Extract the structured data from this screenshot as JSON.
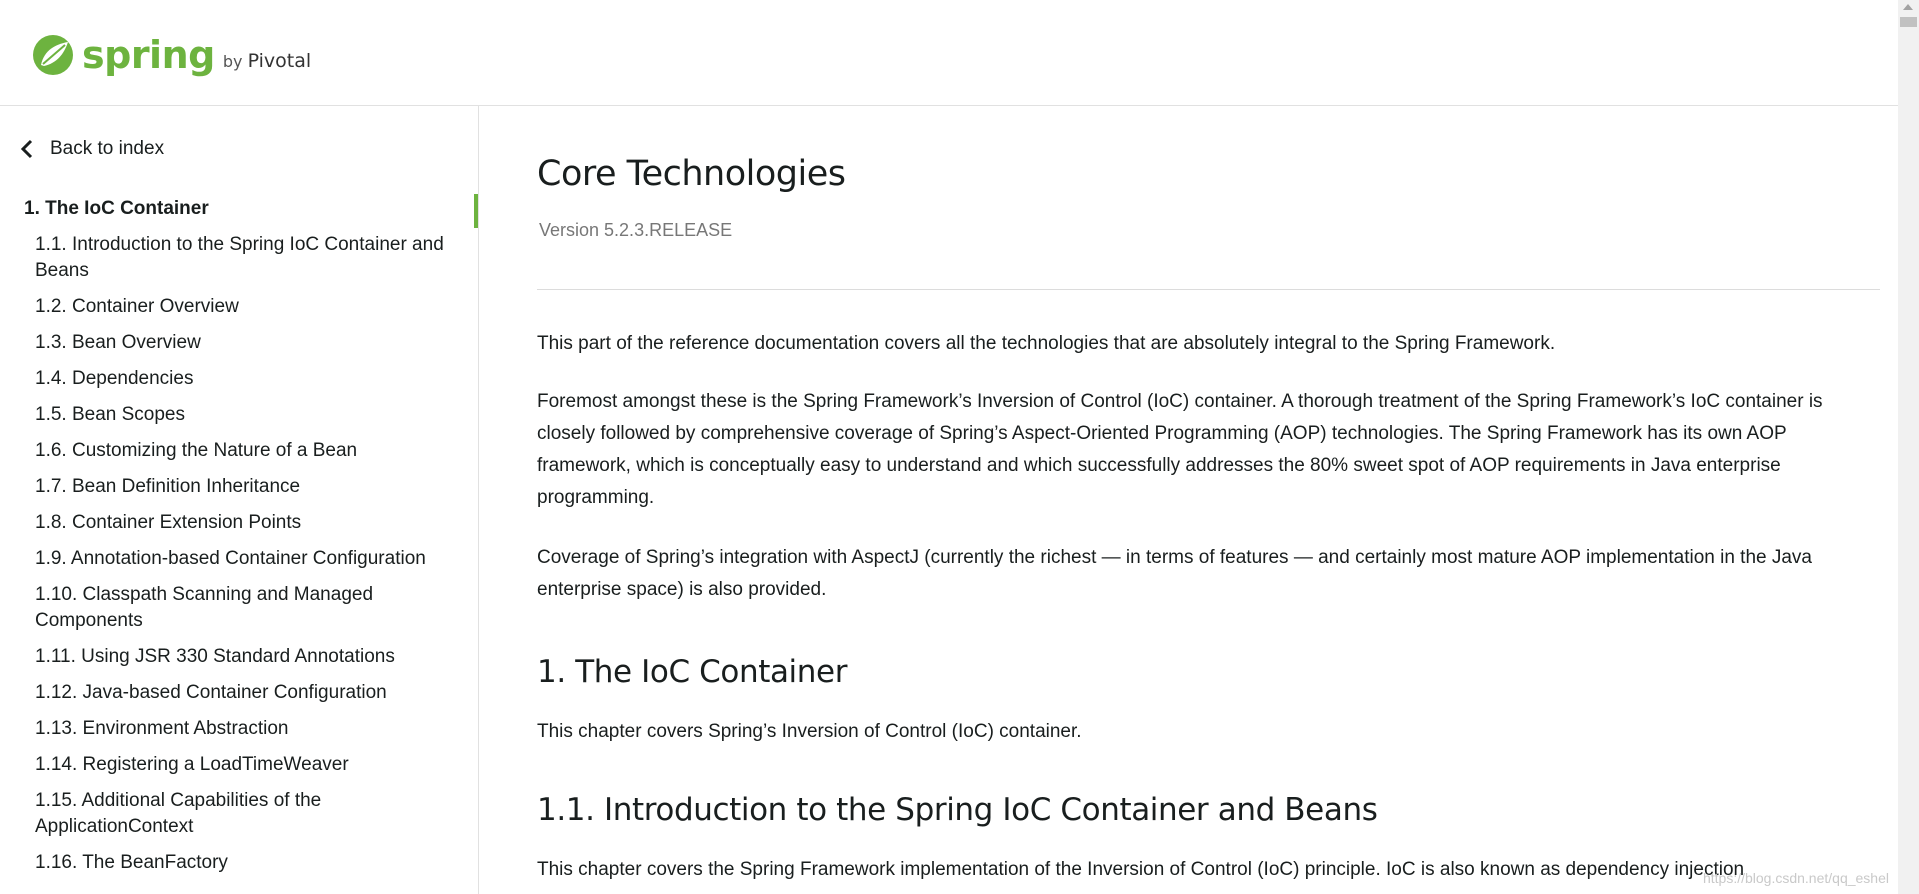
{
  "header": {
    "logo_text": "spring",
    "logo_by": "by",
    "logo_brand": "Pivotal"
  },
  "sidebar": {
    "back_label": "Back to index",
    "toc_top": "1. The IoC Container",
    "items": [
      {
        "label": "1.1. Introduction to the Spring IoC Container and Beans"
      },
      {
        "label": "1.2. Container Overview"
      },
      {
        "label": "1.3. Bean Overview"
      },
      {
        "label": "1.4. Dependencies"
      },
      {
        "label": "1.5. Bean Scopes"
      },
      {
        "label": "1.6. Customizing the Nature of a Bean"
      },
      {
        "label": "1.7. Bean Definition Inheritance"
      },
      {
        "label": "1.8. Container Extension Points"
      },
      {
        "label": "1.9. Annotation-based Container Configuration"
      },
      {
        "label": "1.10. Classpath Scanning and Managed Components"
      },
      {
        "label": "1.11. Using JSR 330 Standard Annotations"
      },
      {
        "label": "1.12. Java-based Container Configuration"
      },
      {
        "label": "1.13. Environment Abstraction"
      },
      {
        "label": "1.14. Registering a LoadTimeWeaver"
      },
      {
        "label": "1.15. Additional Capabilities of the ApplicationContext"
      },
      {
        "label": "1.16. The BeanFactory"
      }
    ]
  },
  "main": {
    "title": "Core Technologies",
    "version": "Version 5.2.3.RELEASE",
    "intro_p1": "This part of the reference documentation covers all the technologies that are absolutely integral to the Spring Framework.",
    "intro_p2": "Foremost amongst these is the Spring Framework’s Inversion of Control (IoC) container. A thorough treatment of the Spring Framework’s IoC container is closely followed by comprehensive coverage of Spring’s Aspect-Oriented Programming (AOP) technologies. The Spring Framework has its own AOP framework, which is conceptually easy to understand and which successfully addresses the 80% sweet spot of AOP requirements in Java enterprise programming.",
    "intro_p3": "Coverage of Spring’s integration with AspectJ (currently the richest — in terms of features — and certainly most mature AOP implementation in the Java enterprise space) is also provided.",
    "section1_title": "1. The IoC Container",
    "section1_p": "This chapter covers Spring’s Inversion of Control (IoC) container.",
    "section11_title": "1.1. Introduction to the Spring IoC Container and Beans",
    "section11_p": "This chapter covers the Spring Framework implementation of the Inversion of Control (IoC) principle. IoC is also known as dependency injection"
  },
  "watermark": "https://blog.csdn.net/qq_eshel",
  "colors": {
    "accent": "#6db33f",
    "text": "#191e1e",
    "muted": "#777777"
  }
}
